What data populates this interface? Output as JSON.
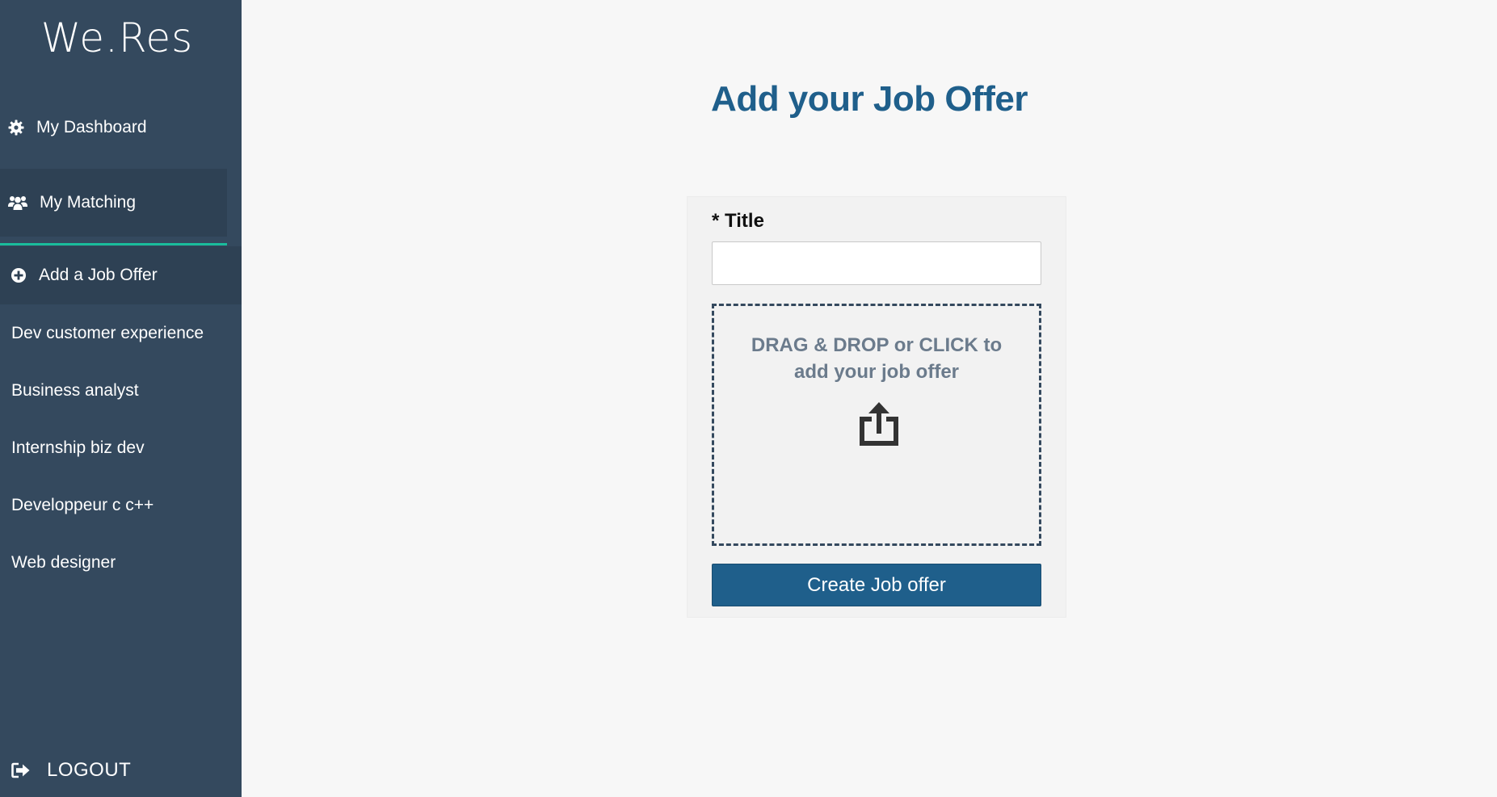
{
  "sidebar": {
    "logo": "We.Res",
    "nav": {
      "dashboard": {
        "label": "My Dashboard",
        "icon": "gear-icon"
      },
      "matching": {
        "label": "My Matching",
        "icon": "users-icon"
      },
      "add_job": {
        "label": "Add a Job Offer",
        "icon": "plus-circle-icon"
      }
    },
    "jobs": [
      "Dev customer experience",
      "Business analyst",
      "Internship biz dev",
      "Developpeur c c++",
      "Web designer"
    ],
    "logout": {
      "label": "LOGOUT",
      "icon": "sign-out-icon"
    }
  },
  "main": {
    "title": "Add your Job Offer",
    "form": {
      "title_label": "* Title",
      "title_value": "",
      "title_placeholder": "",
      "dropzone_text": "DRAG & DROP or CLICK to add your job offer",
      "dropzone_icon": "upload-share-icon",
      "submit_label": "Create Job offer"
    }
  },
  "colors": {
    "sidebar_bg": "#34495e",
    "active_bg": "#2e4154",
    "accent_line": "#1abc9c",
    "primary": "#1f5f8b",
    "page_bg": "#f7f7f7"
  }
}
